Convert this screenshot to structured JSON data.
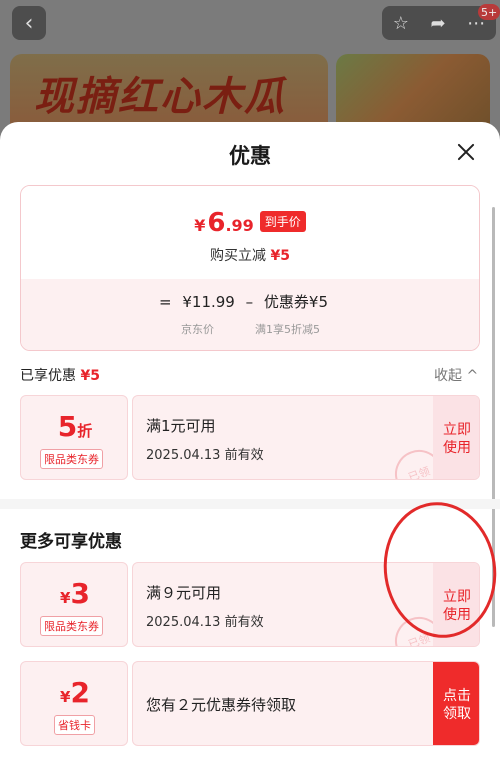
{
  "background": {
    "back_icon": "chevron-left-icon",
    "banner_text": "现摘红心木瓜",
    "badge": "5+",
    "action_icons": [
      "star-icon",
      "share-icon",
      "more-icon"
    ]
  },
  "sheet": {
    "title": "优惠",
    "close_icon": "close-icon"
  },
  "price": {
    "currency": "¥",
    "final_int": "6",
    "final_dec": ".99",
    "final_tag": "到手价",
    "reduce_label": "购买立减",
    "reduce_value": "¥5",
    "formula_eq": "=",
    "jd_price": "¥11.99",
    "formula_minus": "–",
    "coupon_part": "优惠券¥5",
    "jd_price_caption": "京东价",
    "coupon_caption": "满1享5折减5"
  },
  "enjoyed": {
    "label": "已享优惠",
    "value": "¥5",
    "collapse_label": "收起 ^"
  },
  "coupons_enjoyed": [
    {
      "value": "5",
      "unit": "折",
      "type": "限品类东券",
      "condition": "满1元可用",
      "date": "2025.04.13 前有效",
      "action": "立即使用",
      "stamp": "已领"
    }
  ],
  "more": {
    "title": "更多可享优惠"
  },
  "coupons_more": [
    {
      "prefix": "¥",
      "value": "3",
      "type": "限品类东券",
      "condition": "满９元可用",
      "date": "2025.04.13 前有效",
      "action": "立即使用",
      "stamp": "已领"
    },
    {
      "prefix": "¥",
      "value": "2",
      "type": "省钱卡",
      "message": "您有２元优惠券待领取",
      "action": "点击领取"
    }
  ],
  "colors": {
    "accent": "#e8242b",
    "coupon_bg": "#fdf0f1"
  }
}
